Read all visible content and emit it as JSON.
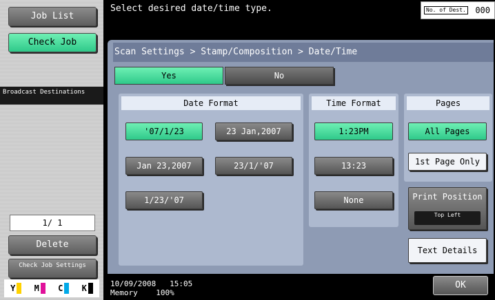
{
  "left": {
    "job_list": "Job List",
    "check_job": "Check Job",
    "broadcast": "Broadcast Destinations",
    "page_count": "1/ 1",
    "delete": "Delete",
    "check_job_settings": "Check Job Settings",
    "toner": [
      {
        "label": "Y",
        "color": "#ffd200"
      },
      {
        "label": "M",
        "color": "#e0119a"
      },
      {
        "label": "C",
        "color": "#00a9e8"
      },
      {
        "label": "K",
        "color": "#000000"
      }
    ]
  },
  "header": {
    "message": "Select desired date/time type.",
    "dest_label": "No. of Dest.",
    "dest_value": "000"
  },
  "breadcrumb": "Scan Settings > Stamp/Composition > Date/Time",
  "toggle": {
    "yes": "Yes",
    "no": "No",
    "selected": "Yes"
  },
  "date_format": {
    "header": "Date Format",
    "options": [
      "'07/1/23",
      "23 Jan,2007",
      "Jan 23,2007",
      "23/1/'07",
      "1/23/'07"
    ],
    "selected": "'07/1/23"
  },
  "time_format": {
    "header": "Time Format",
    "options": [
      "1:23PM",
      "13:23",
      "None"
    ],
    "selected": "1:23PM"
  },
  "pages": {
    "header": "Pages",
    "all_pages": "All Pages",
    "first_page": "1st Page Only",
    "selected": "All Pages"
  },
  "print_position": {
    "label": "Print Position",
    "value": "Top Left"
  },
  "text_details": "Text Details",
  "status": {
    "date": "10/09/2008",
    "time": "15:05",
    "memory_label": "Memory",
    "memory_value": "100%"
  },
  "ok": "OK",
  "colors": {
    "accent_green": "#2fc98a",
    "panel": "#8e9bb4"
  }
}
